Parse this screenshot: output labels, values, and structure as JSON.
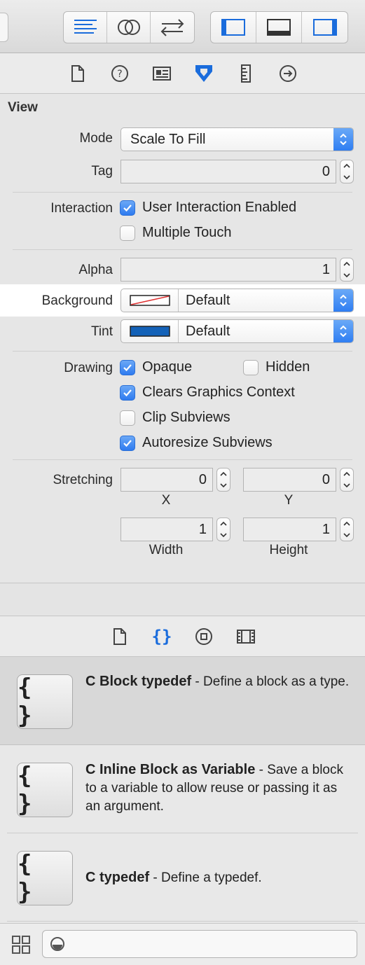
{
  "toolbar": {
    "editor_buttons": [
      "standard-editor",
      "assistant-editor",
      "version-editor"
    ],
    "view_buttons": [
      "navigator-panel",
      "debug-area",
      "utilities-panel"
    ],
    "accent": "#1a6cdc"
  },
  "inspector_tabs": [
    "file-inspector",
    "quick-help",
    "identity-inspector",
    "attributes-inspector",
    "size-inspector",
    "connections-inspector"
  ],
  "view": {
    "title": "View",
    "mode_label": "Mode",
    "mode_value": "Scale To Fill",
    "tag_label": "Tag",
    "tag_value": "0",
    "interaction_label": "Interaction",
    "user_interaction_label": "User Interaction Enabled",
    "user_interaction_checked": true,
    "multiple_touch_label": "Multiple Touch",
    "multiple_touch_checked": false,
    "alpha_label": "Alpha",
    "alpha_value": "1",
    "background_label": "Background",
    "background_value": "Default",
    "tint_label": "Tint",
    "tint_value": "Default",
    "tint_color": "#1462b8",
    "drawing_label": "Drawing",
    "opaque_label": "Opaque",
    "opaque_checked": true,
    "hidden_label": "Hidden",
    "hidden_checked": false,
    "clears_label": "Clears Graphics Context",
    "clears_checked": true,
    "clip_label": "Clip Subviews",
    "clip_checked": false,
    "autoresize_label": "Autoresize Subviews",
    "autoresize_checked": true,
    "stretching_label": "Stretching",
    "stretch_x": "0",
    "stretch_y": "0",
    "stretch_width": "1",
    "stretch_height": "1",
    "x_label": "X",
    "y_label": "Y",
    "width_label": "Width",
    "height_label": "Height"
  },
  "library_tabs": [
    "file-templates",
    "code-snippets",
    "objects",
    "media"
  ],
  "library": [
    {
      "title": "C Block typedef",
      "desc": " - Define a block as a type.",
      "icon_text": "{ }"
    },
    {
      "title": "C Inline Block as Variable",
      "desc": " - Save a block to a variable to allow reuse or passing it as an argument.",
      "icon_text": "{ }"
    },
    {
      "title": "C typedef",
      "desc": " - Define a typedef.",
      "icon_text": "{ }"
    }
  ]
}
